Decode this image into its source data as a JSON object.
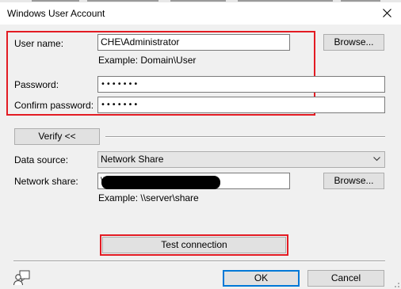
{
  "window": {
    "title": "Windows User Account",
    "close_icon": "close-icon"
  },
  "account": {
    "username_label": "User name:",
    "username_value": "CHE\\Administrator",
    "username_example": "Example: Domain\\User",
    "browse_label": "Browse...",
    "password_label": "Password:",
    "password_value": "•••••••",
    "confirm_label": "Confirm password:",
    "confirm_value": "•••••••"
  },
  "verify": {
    "button_label": "Verify <<"
  },
  "source": {
    "data_source_label": "Data source:",
    "data_source_value": "Network Share",
    "network_share_label": "Network share:",
    "network_share_value": "\\\\",
    "network_share_browse": "Browse...",
    "network_share_example": "Example: \\\\server\\share"
  },
  "actions": {
    "test_connection": "Test connection",
    "ok": "OK",
    "cancel": "Cancel"
  },
  "icons": {
    "help": "user-help-icon",
    "dropdown": "chevron-down-icon"
  },
  "colors": {
    "highlight_red": "#e31b23",
    "default_button_border": "#0078d7",
    "dialog_background": "#f0f0f0"
  }
}
